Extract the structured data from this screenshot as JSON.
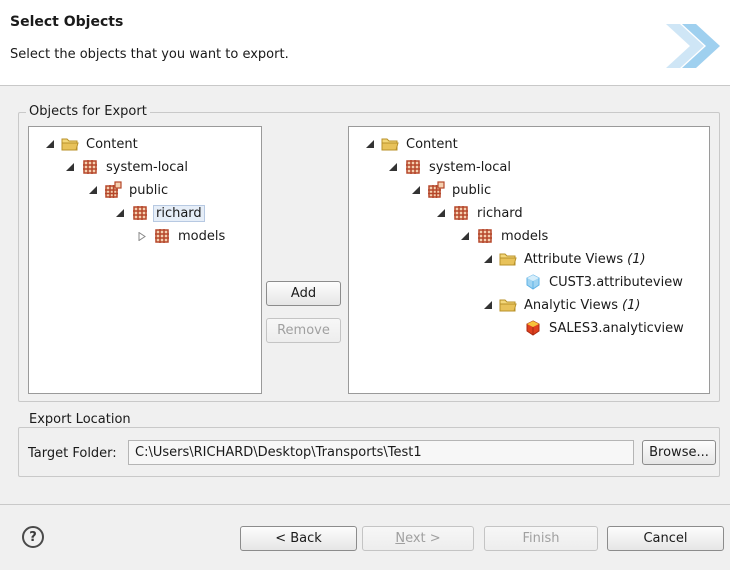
{
  "header": {
    "title": "Select Objects",
    "description": "Select the objects that you want to export."
  },
  "objects_group": {
    "label": "Objects for Export"
  },
  "left_tree": [
    {
      "label": "Content",
      "icon": "folder-icon",
      "twisty": "expanded"
    },
    {
      "label": "system-local",
      "icon": "package-icon",
      "twisty": "expanded"
    },
    {
      "label": "public",
      "icon": "package-public-icon",
      "twisty": "expanded"
    },
    {
      "label": "richard",
      "icon": "package-icon",
      "twisty": "expanded",
      "selected": true
    },
    {
      "label": "models",
      "icon": "package-icon",
      "twisty": "collapsed"
    }
  ],
  "right_tree": [
    {
      "label": "Content",
      "icon": "folder-icon",
      "twisty": "expanded"
    },
    {
      "label": "system-local",
      "icon": "package-icon",
      "twisty": "expanded"
    },
    {
      "label": "public",
      "icon": "package-public-icon",
      "twisty": "expanded"
    },
    {
      "label": "richard",
      "icon": "package-icon",
      "twisty": "expanded"
    },
    {
      "label": "models",
      "icon": "package-icon",
      "twisty": "expanded"
    },
    {
      "label": "Attribute Views",
      "count": "(1)",
      "icon": "folder-icon",
      "twisty": "expanded"
    },
    {
      "label": "CUST3.attributeview",
      "icon": "attribute-view-icon",
      "twisty": "none"
    },
    {
      "label": "Analytic Views",
      "count": "(1)",
      "icon": "folder-icon",
      "twisty": "expanded"
    },
    {
      "label": "SALES3.analyticview",
      "icon": "analytic-view-icon",
      "twisty": "none"
    }
  ],
  "buttons": {
    "add": "Add",
    "remove": "Remove",
    "browse": "Browse...",
    "back": "< Back",
    "next_mnemonic": "N",
    "next_rest": "ext >",
    "finish": "Finish",
    "cancel": "Cancel"
  },
  "export_location": {
    "label": "Export Location",
    "target_label": "Target Folder:",
    "target_value": "C:\\Users\\RICHARD\\Desktop\\Transports\\Test1"
  },
  "help": {
    "glyph": "?"
  },
  "colors": {
    "folder": "#e8c25a",
    "package": "#b5472a",
    "attribute_view": "#5fb2e6",
    "analytic_view": "#e0401f",
    "banner": "#9fd0ef"
  }
}
